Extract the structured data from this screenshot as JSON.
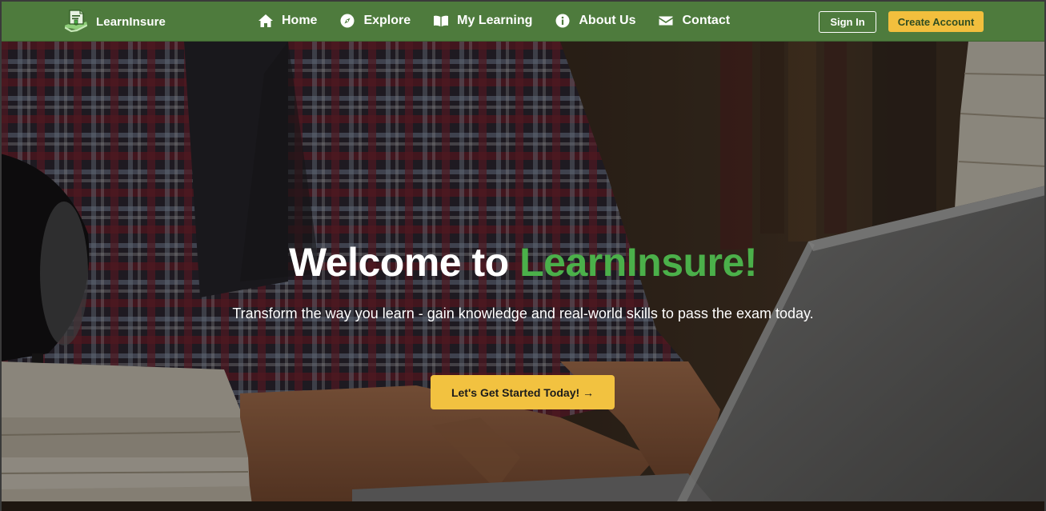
{
  "brand": {
    "name": "LearnInsure",
    "logo_icon": "shield-document-icon"
  },
  "nav": {
    "items": [
      {
        "label": "Home",
        "icon": "home-icon"
      },
      {
        "label": "Explore",
        "icon": "compass-icon"
      },
      {
        "label": "My Learning",
        "icon": "book-open-icon"
      },
      {
        "label": "About Us",
        "icon": "info-icon"
      },
      {
        "label": "Contact",
        "icon": "envelope-icon"
      }
    ],
    "signin_label": "Sign In",
    "create_account_label": "Create Account"
  },
  "hero": {
    "title_prefix": "Welcome to ",
    "title_accent": "LearnInsure!",
    "subtitle": "Transform the way you learn - gain knowledge and real-world skills to pass the exam today.",
    "cta_label": "Let's Get Started Today! →"
  },
  "colors": {
    "navbar": "#4e7b3d",
    "accent_green": "#4bb04a",
    "cta_yellow": "#f2c240",
    "text_white": "#ffffff"
  }
}
